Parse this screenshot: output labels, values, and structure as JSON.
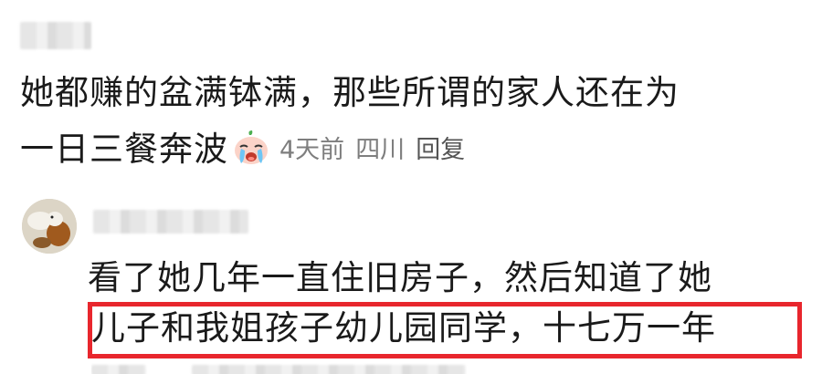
{
  "comment1": {
    "text_line1": "她都赚的盆满钵满，那些所谓的家人还在为",
    "text_line2": "一日三餐奔波",
    "emoji": "crying-face-icon",
    "time": "4天前",
    "location": "四川",
    "reply_label": "回复"
  },
  "comment2": {
    "text_line1": "看了她几年一直住旧房子，然后知道了她",
    "text_line2": "儿子和我姐孩子幼儿园同学，十七万一年"
  },
  "colors": {
    "highlight_border": "#e8262d",
    "meta_text": "#7e7e7e",
    "body_text": "#1a1a1a"
  }
}
